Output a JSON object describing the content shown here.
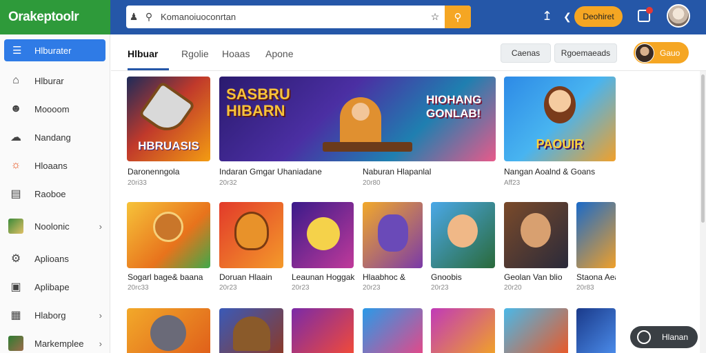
{
  "app": {
    "logo": "Orakeptoolr"
  },
  "search": {
    "value": "Komanoiuoconrtan",
    "placeholder": ""
  },
  "topbar": {
    "action_label": "Deohiret"
  },
  "sidebar": {
    "active": {
      "label": "Hlburater",
      "icon": "list-icon"
    },
    "items": [
      {
        "label": "Hlburar",
        "icon": "home-icon"
      },
      {
        "label": "Moooom",
        "icon": "avatar-icon"
      },
      {
        "label": "Nandang",
        "icon": "cloud-icon"
      },
      {
        "label": "Hloaans",
        "icon": "fire-icon"
      },
      {
        "label": "Raoboe",
        "icon": "table-icon"
      },
      {
        "label": "Noolonic",
        "icon": "game-thumb-icon",
        "chevron": true
      },
      {
        "label": "Aplioans",
        "icon": "gear-icon"
      },
      {
        "label": "Aplibape",
        "icon": "badge-icon"
      },
      {
        "label": "Hlaborg",
        "icon": "grid-icon",
        "chevron": true
      },
      {
        "label": "Markemplee",
        "icon": "store-thumb-icon",
        "chevron": true
      }
    ]
  },
  "tabs": [
    {
      "label": "Hlbuar",
      "active": true
    },
    {
      "label": "Rgolie"
    },
    {
      "label": "Hoaas"
    },
    {
      "label": "Apone"
    }
  ],
  "actions": {
    "btn1": "Caenas",
    "btn2": "Rgoemaeads",
    "user": "Gauo"
  },
  "featured": [
    {
      "title": "Daronenngola",
      "sub": "20ri33",
      "art": "HBRUASIS"
    },
    {
      "title": "Indaran Gmgar Uhaniadane",
      "sub": "20r32",
      "art": "SASBRU HIBARN"
    },
    {
      "title": "Naburan Hlapanlal",
      "sub": "20r80",
      "art": "HIOHANG GONLAB!"
    },
    {
      "title": "Nangan Aoalnd & Goans",
      "sub": "Aff23",
      "art": "PAOUIR"
    }
  ],
  "grid_row1": [
    {
      "title": "Sogarl bage& baana",
      "sub": "20rc33"
    },
    {
      "title": "Doruan Hlaain",
      "sub": "20r23"
    },
    {
      "title": "Leaunan Hoggak",
      "sub": "20r23"
    },
    {
      "title": "Hlaabhoc &",
      "sub": "20r23"
    },
    {
      "title": "Gnoobis",
      "sub": "20r23"
    },
    {
      "title": "Geolan Van blio",
      "sub": "20r20"
    },
    {
      "title": "Staona Aea",
      "sub": "20r83"
    }
  ],
  "floating": {
    "label": "Hlanan"
  }
}
